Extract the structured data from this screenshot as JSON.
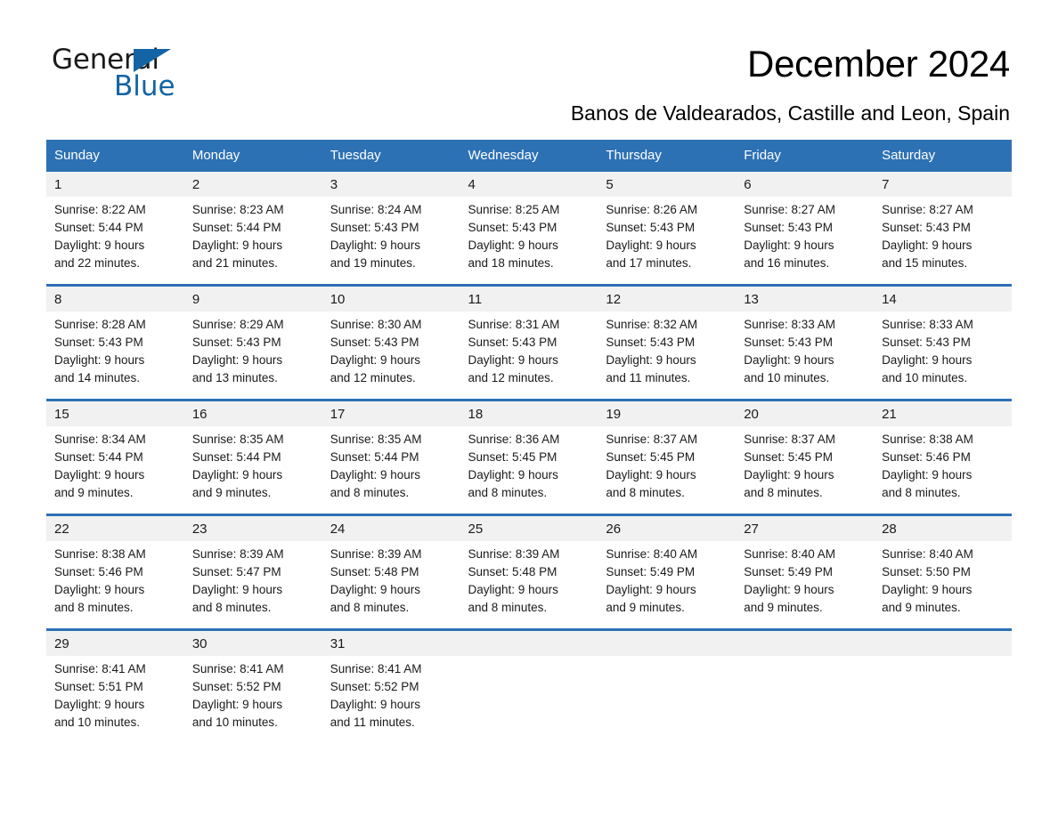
{
  "logo": {
    "line1": "General",
    "line2": "Blue",
    "triangle_color": "#1464a5",
    "text_color": "#1a1a1a"
  },
  "header": {
    "title": "December 2024",
    "subtitle": "Banos de Valdearados, Castille and Leon, Spain"
  },
  "theme": {
    "header_blue": "#2d71b5",
    "daynum_band": "#f1f1f1",
    "page_background": "#ffffff",
    "text": "#1a1a1a"
  },
  "calendar": {
    "weekday_headers": [
      "Sunday",
      "Monday",
      "Tuesday",
      "Wednesday",
      "Thursday",
      "Friday",
      "Saturday"
    ],
    "weeks": [
      [
        {
          "day": "1",
          "sunrise": "Sunrise: 8:22 AM",
          "sunset": "Sunset: 5:44 PM",
          "daylight_1": "Daylight: 9 hours",
          "daylight_2": "and 22 minutes."
        },
        {
          "day": "2",
          "sunrise": "Sunrise: 8:23 AM",
          "sunset": "Sunset: 5:44 PM",
          "daylight_1": "Daylight: 9 hours",
          "daylight_2": "and 21 minutes."
        },
        {
          "day": "3",
          "sunrise": "Sunrise: 8:24 AM",
          "sunset": "Sunset: 5:43 PM",
          "daylight_1": "Daylight: 9 hours",
          "daylight_2": "and 19 minutes."
        },
        {
          "day": "4",
          "sunrise": "Sunrise: 8:25 AM",
          "sunset": "Sunset: 5:43 PM",
          "daylight_1": "Daylight: 9 hours",
          "daylight_2": "and 18 minutes."
        },
        {
          "day": "5",
          "sunrise": "Sunrise: 8:26 AM",
          "sunset": "Sunset: 5:43 PM",
          "daylight_1": "Daylight: 9 hours",
          "daylight_2": "and 17 minutes."
        },
        {
          "day": "6",
          "sunrise": "Sunrise: 8:27 AM",
          "sunset": "Sunset: 5:43 PM",
          "daylight_1": "Daylight: 9 hours",
          "daylight_2": "and 16 minutes."
        },
        {
          "day": "7",
          "sunrise": "Sunrise: 8:27 AM",
          "sunset": "Sunset: 5:43 PM",
          "daylight_1": "Daylight: 9 hours",
          "daylight_2": "and 15 minutes."
        }
      ],
      [
        {
          "day": "8",
          "sunrise": "Sunrise: 8:28 AM",
          "sunset": "Sunset: 5:43 PM",
          "daylight_1": "Daylight: 9 hours",
          "daylight_2": "and 14 minutes."
        },
        {
          "day": "9",
          "sunrise": "Sunrise: 8:29 AM",
          "sunset": "Sunset: 5:43 PM",
          "daylight_1": "Daylight: 9 hours",
          "daylight_2": "and 13 minutes."
        },
        {
          "day": "10",
          "sunrise": "Sunrise: 8:30 AM",
          "sunset": "Sunset: 5:43 PM",
          "daylight_1": "Daylight: 9 hours",
          "daylight_2": "and 12 minutes."
        },
        {
          "day": "11",
          "sunrise": "Sunrise: 8:31 AM",
          "sunset": "Sunset: 5:43 PM",
          "daylight_1": "Daylight: 9 hours",
          "daylight_2": "and 12 minutes."
        },
        {
          "day": "12",
          "sunrise": "Sunrise: 8:32 AM",
          "sunset": "Sunset: 5:43 PM",
          "daylight_1": "Daylight: 9 hours",
          "daylight_2": "and 11 minutes."
        },
        {
          "day": "13",
          "sunrise": "Sunrise: 8:33 AM",
          "sunset": "Sunset: 5:43 PM",
          "daylight_1": "Daylight: 9 hours",
          "daylight_2": "and 10 minutes."
        },
        {
          "day": "14",
          "sunrise": "Sunrise: 8:33 AM",
          "sunset": "Sunset: 5:43 PM",
          "daylight_1": "Daylight: 9 hours",
          "daylight_2": "and 10 minutes."
        }
      ],
      [
        {
          "day": "15",
          "sunrise": "Sunrise: 8:34 AM",
          "sunset": "Sunset: 5:44 PM",
          "daylight_1": "Daylight: 9 hours",
          "daylight_2": "and 9 minutes."
        },
        {
          "day": "16",
          "sunrise": "Sunrise: 8:35 AM",
          "sunset": "Sunset: 5:44 PM",
          "daylight_1": "Daylight: 9 hours",
          "daylight_2": "and 9 minutes."
        },
        {
          "day": "17",
          "sunrise": "Sunrise: 8:35 AM",
          "sunset": "Sunset: 5:44 PM",
          "daylight_1": "Daylight: 9 hours",
          "daylight_2": "and 8 minutes."
        },
        {
          "day": "18",
          "sunrise": "Sunrise: 8:36 AM",
          "sunset": "Sunset: 5:45 PM",
          "daylight_1": "Daylight: 9 hours",
          "daylight_2": "and 8 minutes."
        },
        {
          "day": "19",
          "sunrise": "Sunrise: 8:37 AM",
          "sunset": "Sunset: 5:45 PM",
          "daylight_1": "Daylight: 9 hours",
          "daylight_2": "and 8 minutes."
        },
        {
          "day": "20",
          "sunrise": "Sunrise: 8:37 AM",
          "sunset": "Sunset: 5:45 PM",
          "daylight_1": "Daylight: 9 hours",
          "daylight_2": "and 8 minutes."
        },
        {
          "day": "21",
          "sunrise": "Sunrise: 8:38 AM",
          "sunset": "Sunset: 5:46 PM",
          "daylight_1": "Daylight: 9 hours",
          "daylight_2": "and 8 minutes."
        }
      ],
      [
        {
          "day": "22",
          "sunrise": "Sunrise: 8:38 AM",
          "sunset": "Sunset: 5:46 PM",
          "daylight_1": "Daylight: 9 hours",
          "daylight_2": "and 8 minutes."
        },
        {
          "day": "23",
          "sunrise": "Sunrise: 8:39 AM",
          "sunset": "Sunset: 5:47 PM",
          "daylight_1": "Daylight: 9 hours",
          "daylight_2": "and 8 minutes."
        },
        {
          "day": "24",
          "sunrise": "Sunrise: 8:39 AM",
          "sunset": "Sunset: 5:48 PM",
          "daylight_1": "Daylight: 9 hours",
          "daylight_2": "and 8 minutes."
        },
        {
          "day": "25",
          "sunrise": "Sunrise: 8:39 AM",
          "sunset": "Sunset: 5:48 PM",
          "daylight_1": "Daylight: 9 hours",
          "daylight_2": "and 8 minutes."
        },
        {
          "day": "26",
          "sunrise": "Sunrise: 8:40 AM",
          "sunset": "Sunset: 5:49 PM",
          "daylight_1": "Daylight: 9 hours",
          "daylight_2": "and 9 minutes."
        },
        {
          "day": "27",
          "sunrise": "Sunrise: 8:40 AM",
          "sunset": "Sunset: 5:49 PM",
          "daylight_1": "Daylight: 9 hours",
          "daylight_2": "and 9 minutes."
        },
        {
          "day": "28",
          "sunrise": "Sunrise: 8:40 AM",
          "sunset": "Sunset: 5:50 PM",
          "daylight_1": "Daylight: 9 hours",
          "daylight_2": "and 9 minutes."
        }
      ],
      [
        {
          "day": "29",
          "sunrise": "Sunrise: 8:41 AM",
          "sunset": "Sunset: 5:51 PM",
          "daylight_1": "Daylight: 9 hours",
          "daylight_2": "and 10 minutes."
        },
        {
          "day": "30",
          "sunrise": "Sunrise: 8:41 AM",
          "sunset": "Sunset: 5:52 PM",
          "daylight_1": "Daylight: 9 hours",
          "daylight_2": "and 10 minutes."
        },
        {
          "day": "31",
          "sunrise": "Sunrise: 8:41 AM",
          "sunset": "Sunset: 5:52 PM",
          "daylight_1": "Daylight: 9 hours",
          "daylight_2": "and 11 minutes."
        },
        {
          "day": "",
          "sunrise": "",
          "sunset": "",
          "daylight_1": "",
          "daylight_2": ""
        },
        {
          "day": "",
          "sunrise": "",
          "sunset": "",
          "daylight_1": "",
          "daylight_2": ""
        },
        {
          "day": "",
          "sunrise": "",
          "sunset": "",
          "daylight_1": "",
          "daylight_2": ""
        },
        {
          "day": "",
          "sunrise": "",
          "sunset": "",
          "daylight_1": "",
          "daylight_2": ""
        }
      ]
    ]
  }
}
